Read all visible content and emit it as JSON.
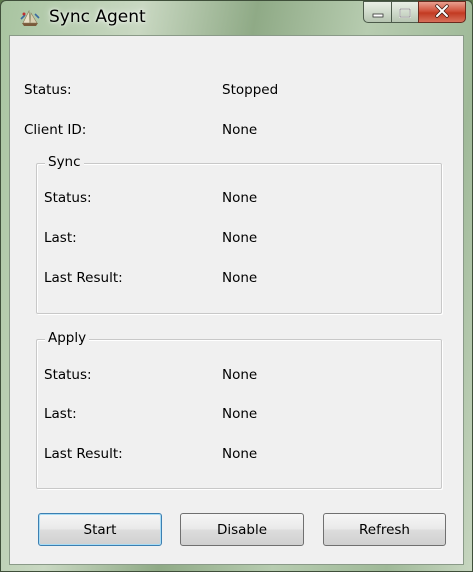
{
  "window": {
    "title": "Sync Agent",
    "icon": "sync-agent-app-icon"
  },
  "general": {
    "status_label": "Status:",
    "status_value": "Stopped",
    "client_id_label": "Client ID:",
    "client_id_value": "None"
  },
  "sync_group": {
    "title": "Sync",
    "status_label": "Status:",
    "status_value": "None",
    "last_label": "Last:",
    "last_value": "None",
    "last_result_label": "Last Result:",
    "last_result_value": "None"
  },
  "apply_group": {
    "title": "Apply",
    "status_label": "Status:",
    "status_value": "None",
    "last_label": "Last:",
    "last_value": "None",
    "last_result_label": "Last Result:",
    "last_result_value": "None"
  },
  "buttons": {
    "start": "Start",
    "disable": "Disable",
    "refresh": "Refresh"
  },
  "colors": {
    "client_bg": "#f0f0f0",
    "close_button": "#c23a22"
  }
}
